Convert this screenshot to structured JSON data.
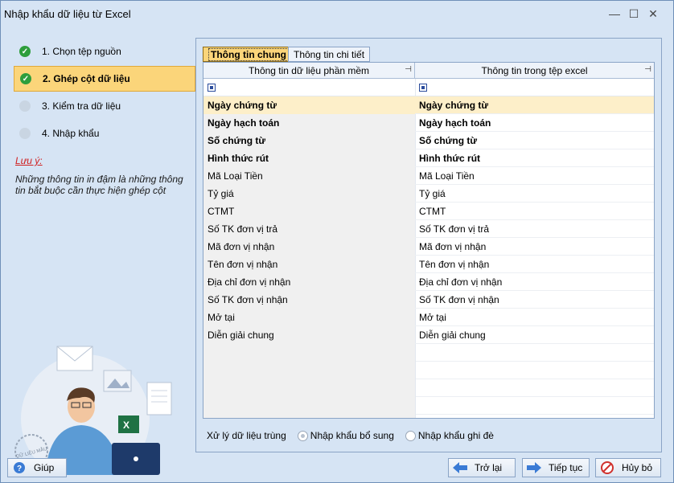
{
  "window": {
    "title": "Nhập khẩu dữ liệu từ Excel",
    "minimize_glyph": "—",
    "maximize_glyph": "☐",
    "close_glyph": "✕"
  },
  "steps": [
    {
      "label": "1. Chọn tệp nguồn",
      "state": "done"
    },
    {
      "label": "2. Ghép cột dữ liệu",
      "state": "active"
    },
    {
      "label": "3. Kiểm tra dữ liệu",
      "state": "pending"
    },
    {
      "label": "4. Nhập khẩu",
      "state": "pending"
    }
  ],
  "note": {
    "title": "Lưu ý:",
    "text": "Những thông tin in đậm là những thông tin bắt buộc cần thực hiện ghép cột"
  },
  "illustration": {
    "stamp_text": "DỮ LIỆU MẪU"
  },
  "tabs": [
    {
      "label": "Thông tin chung",
      "active": true
    },
    {
      "label": "Thông tin chi tiết",
      "active": false
    }
  ],
  "grid": {
    "columns": [
      "Thông tin dữ liệu phần mềm",
      "Thông tin trong tệp excel"
    ],
    "rows": [
      {
        "software": "Ngày chứng từ",
        "excel": "Ngày chứng từ",
        "required": true,
        "selected": true
      },
      {
        "software": "Ngày hạch toán",
        "excel": "Ngày hạch toán",
        "required": true,
        "selected": false
      },
      {
        "software": "Số chứng từ",
        "excel": "Số chứng từ",
        "required": true,
        "selected": false
      },
      {
        "software": "Hình thức rút",
        "excel": "Hình thức rút",
        "required": true,
        "selected": false
      },
      {
        "software": "Mã Loại Tiền",
        "excel": "Mã Loại Tiền",
        "required": false,
        "selected": false
      },
      {
        "software": "Tỷ giá",
        "excel": "Tỷ giá",
        "required": false,
        "selected": false
      },
      {
        "software": "CTMT",
        "excel": "CTMT",
        "required": false,
        "selected": false
      },
      {
        "software": "Số TK đơn vị trả",
        "excel": "Số TK đơn vị trả",
        "required": false,
        "selected": false
      },
      {
        "software": "Mã đơn vị nhận",
        "excel": "Mã đơn vị nhận",
        "required": false,
        "selected": false
      },
      {
        "software": "Tên đơn vị nhận",
        "excel": "Tên đơn vị nhận",
        "required": false,
        "selected": false
      },
      {
        "software": "Địa chỉ đơn vị nhận",
        "excel": "Địa chỉ đơn vị nhận",
        "required": false,
        "selected": false
      },
      {
        "software": "Số TK đơn vị nhận",
        "excel": "Số TK đơn vị nhận",
        "required": false,
        "selected": false
      },
      {
        "software": "Mở tại",
        "excel": "Mở tại",
        "required": false,
        "selected": false
      },
      {
        "software": "Diễn giải chung",
        "excel": "Diễn giải chung",
        "required": false,
        "selected": false
      }
    ]
  },
  "duplicate": {
    "label": "Xử lý dữ liệu trùng",
    "options": [
      {
        "label": "Nhập khẩu bổ sung",
        "checked": true
      },
      {
        "label": "Nhập khẩu ghi đè",
        "checked": false
      }
    ]
  },
  "buttons": {
    "help": "Giúp",
    "back": "Trở lại",
    "next": "Tiếp tục",
    "cancel": "Hủy bỏ"
  }
}
